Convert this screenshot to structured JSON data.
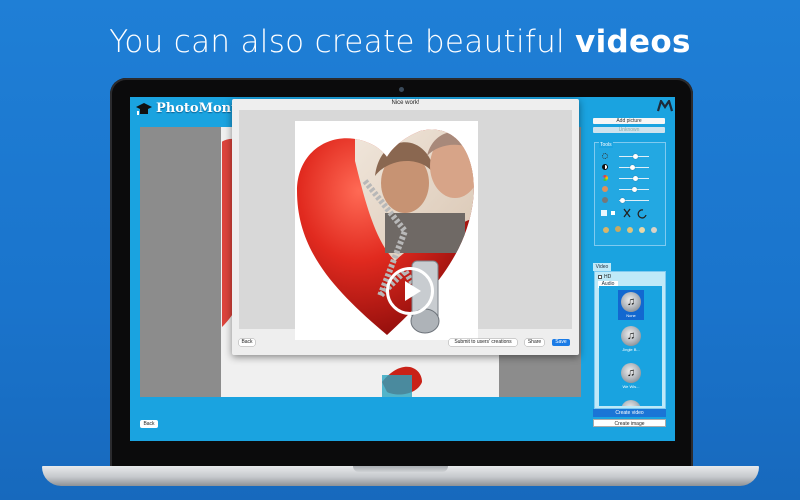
{
  "headline": {
    "text": "You can also create beautiful ",
    "emphasis": "videos"
  },
  "app": {
    "name": "PhotoMonta",
    "back_label": "Back"
  },
  "right_panel": {
    "add_picture": "Add picture",
    "disabled_button": "Unknown",
    "tools_label": "Tools",
    "sliders": [
      {
        "icon": "brightness-icon",
        "value": 0.55
      },
      {
        "icon": "contrast-icon",
        "value": 0.45
      },
      {
        "icon": "saturation-icon",
        "value": 0.55
      },
      {
        "icon": "hue-icon",
        "value": 0.5
      },
      {
        "icon": "blur-icon",
        "value": 0.1
      }
    ],
    "video_label": "Video",
    "hd_label": "HD",
    "audio_label": "Audio",
    "tracks": [
      {
        "name": "None",
        "selected": true
      },
      {
        "name": "Jingle B...",
        "selected": false
      },
      {
        "name": "We Wis...",
        "selected": false
      }
    ],
    "create_video": "Create video",
    "create_image": "Create image"
  },
  "modal": {
    "title": "Nice work!",
    "back": "Back",
    "submit": "Submit to users' creations",
    "share": "Share",
    "save": "Save"
  },
  "colors": {
    "background": "#1f7fd6",
    "screen": "#1aa3e0",
    "accent": "#1a7be6",
    "heart": "#d8261c"
  }
}
